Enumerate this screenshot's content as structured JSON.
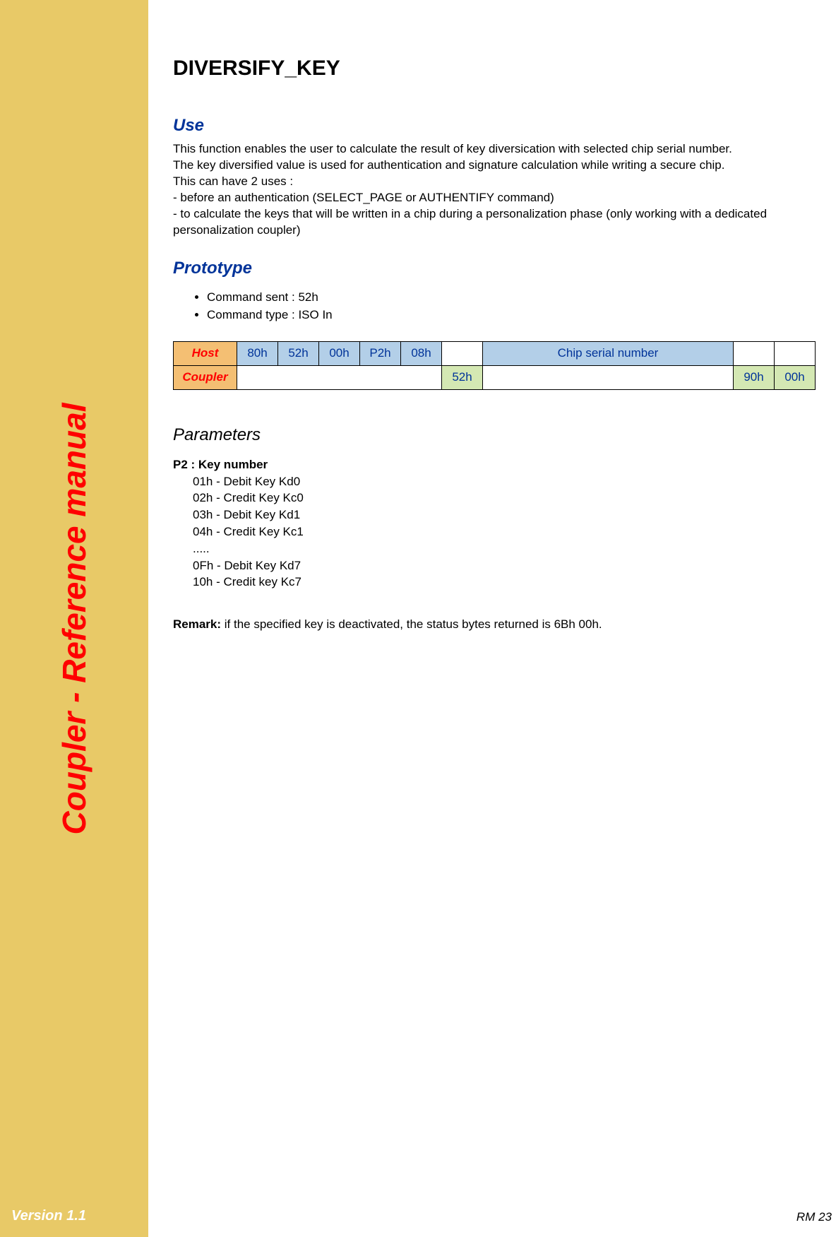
{
  "sidebar": {
    "title": "Coupler - Reference manual",
    "version": "Version 1.1"
  },
  "page": {
    "title": "DIVERSIFY_KEY",
    "page_number": "RM 23"
  },
  "use": {
    "heading": "Use",
    "p1": "This function enables the user to calculate the result of key diversication with selected chip serial number.",
    "p2": "The key diversified value is used for authentication and signature calculation while writing a secure chip.",
    "p3": "This can have 2 uses :",
    "p4": "- before an authentication (SELECT_PAGE or AUTHENTIFY command)",
    "p5": "- to calculate the keys that will be written in a chip during a personalization phase (only working with a dedicated personalization coupler)"
  },
  "prototype": {
    "heading": "Prototype",
    "b1": "Command sent : 52h",
    "b2": "Command type : ISO In"
  },
  "table": {
    "host_label": "Host",
    "coupler_label": "Coupler",
    "host_cells": [
      "80h",
      "52h",
      "00h",
      "P2h",
      "08h"
    ],
    "host_chip": "Chip serial number",
    "coupler_resp": "52h",
    "coupler_sw1": "90h",
    "coupler_sw2": "00h"
  },
  "parameters": {
    "heading": "Parameters",
    "p2_title": "P2 : Key number",
    "items": [
      "01h - Debit Key Kd0",
      "02h - Credit Key Kc0",
      "03h - Debit Key Kd1",
      "04h - Credit Key Kc1",
      "   .....",
      "0Fh - Debit Key Kd7",
      "10h - Credit key Kc7"
    ]
  },
  "remark": {
    "label": "Remark:",
    "text": " if the specified key is deactivated, the status bytes returned is 6Bh 00h."
  }
}
